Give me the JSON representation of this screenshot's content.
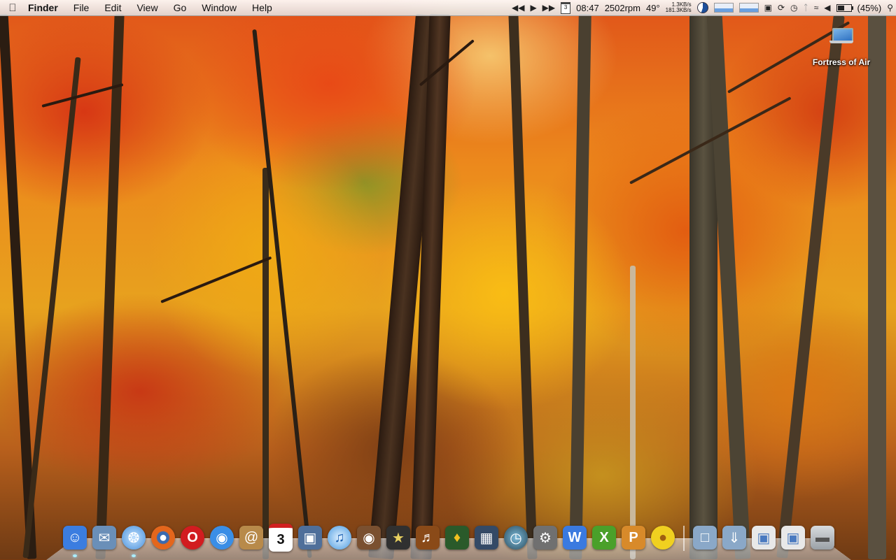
{
  "menubar": {
    "app_name": "Finder",
    "menus": [
      "File",
      "Edit",
      "View",
      "Go",
      "Window",
      "Help"
    ],
    "calendar_day": "3",
    "clock": "08:47",
    "fan_speed": "2502rpm",
    "temperature": "49°",
    "net_up": "1.3KB/s",
    "net_down": "181.3KB/s",
    "battery": "(45%)",
    "icons": [
      "apple-icon",
      "rewind-icon",
      "play-icon",
      "fast-forward-icon",
      "calendar-icon",
      "cpu-pie-icon",
      "activity-graph-icon",
      "display-icon",
      "sync-icon",
      "time-machine-icon",
      "bluetooth-icon",
      "wifi-icon",
      "volume-icon",
      "battery-icon",
      "spotlight-icon"
    ]
  },
  "desktop": {
    "volume_label": "Fortress of Air"
  },
  "dock": {
    "calendar_day": "3",
    "apps": [
      {
        "name": "finder",
        "color": "#3b7de0"
      },
      {
        "name": "preview",
        "color": "#6a8fb8"
      },
      {
        "name": "safari",
        "color": "#4a90d9"
      },
      {
        "name": "firefox",
        "color": "#e4661c"
      },
      {
        "name": "opera",
        "color": "#d21c20"
      },
      {
        "name": "ichat",
        "color": "#3a8ee6"
      },
      {
        "name": "address-book",
        "color": "#b88a4a"
      },
      {
        "name": "ical",
        "color": "#ffffff"
      },
      {
        "name": "iphoto",
        "color": "#4f6f9a"
      },
      {
        "name": "itunes",
        "color": "#4a9be0"
      },
      {
        "name": "photo-booth",
        "color": "#7a5030"
      },
      {
        "name": "imovie",
        "color": "#303030"
      },
      {
        "name": "garageband",
        "color": "#8a4a18"
      },
      {
        "name": "cocktail",
        "color": "#2a5a2a"
      },
      {
        "name": "dashboard",
        "color": "#344a66"
      },
      {
        "name": "time-machine",
        "color": "#2a4a5a"
      },
      {
        "name": "system-preferences",
        "color": "#707070"
      },
      {
        "name": "w-app",
        "color": "#3a7ae0"
      },
      {
        "name": "x-app",
        "color": "#4aa02a"
      },
      {
        "name": "p-app",
        "color": "#d88a2a"
      },
      {
        "name": "cyberduck",
        "color": "#f0d020"
      }
    ],
    "stacks": [
      {
        "name": "documents-stack",
        "color": "#8aa8c8"
      },
      {
        "name": "downloads-stack",
        "color": "#8aa8c8"
      },
      {
        "name": "web-document",
        "color": "#e8e8e8"
      },
      {
        "name": "web-document-2",
        "color": "#e8e8e8"
      },
      {
        "name": "trash",
        "color": "#b0b4b8"
      }
    ]
  }
}
